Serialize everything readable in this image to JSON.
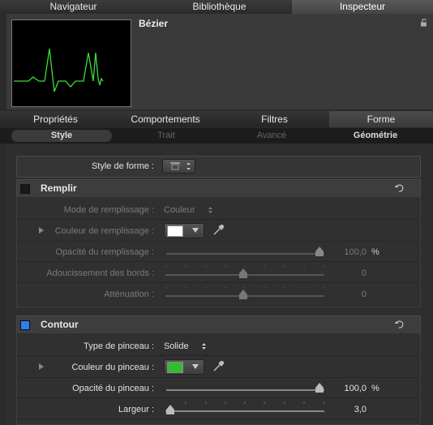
{
  "top_tabs": [
    "Navigateur",
    "Bibliothèque",
    "Inspecteur"
  ],
  "object_title": "Bézier",
  "sub_tabs": [
    "Propriétés",
    "Comportements",
    "Filtres",
    "Forme"
  ],
  "segments": [
    "Style",
    "Trait",
    "Avancé",
    "Géométrie"
  ],
  "shape_style": {
    "label": "Style de forme :"
  },
  "fill": {
    "title": "Remplir",
    "mode_label": "Mode de remplissage :",
    "mode_value": "Couleur",
    "color_label": "Couleur de remplissage :",
    "color_hex": "#ffffff",
    "opacity_label": "Opacité du remplissage :",
    "opacity_value": "100,0",
    "opacity_unit": "%",
    "opacity_level": 1.0,
    "feather_label": "Adoucissement des bords :",
    "feather_value": "0",
    "falloff_label": "Atténuation :",
    "falloff_value": "0"
  },
  "outline": {
    "title": "Contour",
    "checkbox_color": "#2f7df5",
    "brush_type_label": "Type de pinceau :",
    "brush_type_value": "Solide",
    "color_label": "Couleur du pinceau :",
    "color_hex": "#33bb33",
    "opacity_label": "Opacité du pinceau :",
    "opacity_value": "100,0",
    "opacity_unit": "%",
    "opacity_level": 1.0,
    "width_label": "Largeur :",
    "width_value": "3,0"
  },
  "colors": {
    "preview_line": "#3cdc3c",
    "accent": "#2f7df5"
  },
  "icons": [
    "lock-icon",
    "shape-style-icon",
    "reset-icon",
    "eyedropper-icon",
    "disclosure-triangle-icon",
    "updown-arrows-icon"
  ]
}
